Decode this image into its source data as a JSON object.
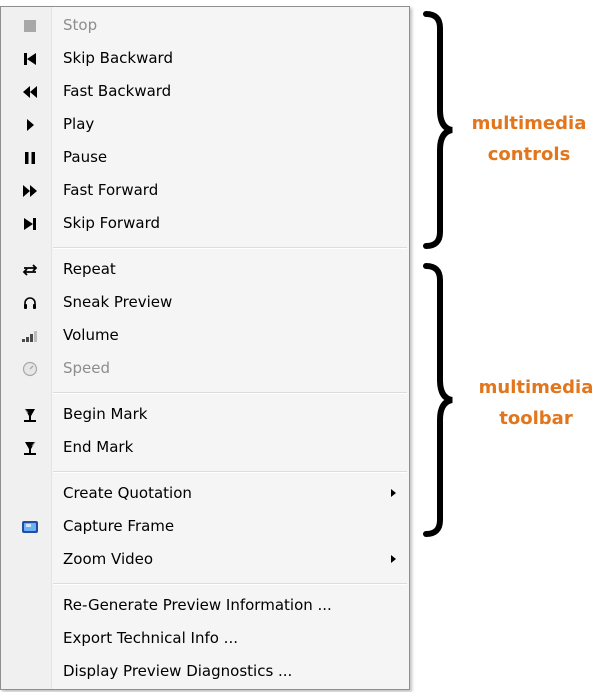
{
  "menu": {
    "items": [
      {
        "label": "Stop",
        "icon": "stop-icon"
      },
      {
        "label": "Skip Backward",
        "icon": "skip-backward-icon"
      },
      {
        "label": "Fast Backward",
        "icon": "fast-backward-icon"
      },
      {
        "label": "Play",
        "icon": "play-icon"
      },
      {
        "label": "Pause",
        "icon": "pause-icon"
      },
      {
        "label": "Fast Forward",
        "icon": "fast-forward-icon"
      },
      {
        "label": "Skip Forward",
        "icon": "skip-forward-icon"
      },
      {
        "label": "Repeat",
        "icon": "repeat-icon"
      },
      {
        "label": "Sneak Preview",
        "icon": "headphones-icon"
      },
      {
        "label": "Volume",
        "icon": "volume-icon"
      },
      {
        "label": "Speed",
        "icon": "speed-gauge-icon"
      },
      {
        "label": "Begin Mark",
        "icon": "begin-mark-icon"
      },
      {
        "label": "End Mark",
        "icon": "end-mark-icon"
      },
      {
        "label": "Create Quotation",
        "icon": "submenu-arrow-icon"
      },
      {
        "label": "Capture Frame",
        "icon": "capture-frame-icon"
      },
      {
        "label": "Zoom Video",
        "icon": "submenu-arrow-icon"
      },
      {
        "label": "Re-Generate Preview Information ...",
        "icon": ""
      },
      {
        "label": "Export Technical Info ...",
        "icon": ""
      },
      {
        "label": "Display Preview Diagnostics ...",
        "icon": ""
      }
    ]
  },
  "annotations": {
    "controls_line1": "multimedia",
    "controls_line2": "controls",
    "toolbar_line1": "multimedia",
    "toolbar_line2": "toolbar"
  },
  "colors": {
    "annotation": "#e2761d",
    "disabled_text": "#8d8d8d",
    "capture_icon": "#3a7bd5"
  }
}
